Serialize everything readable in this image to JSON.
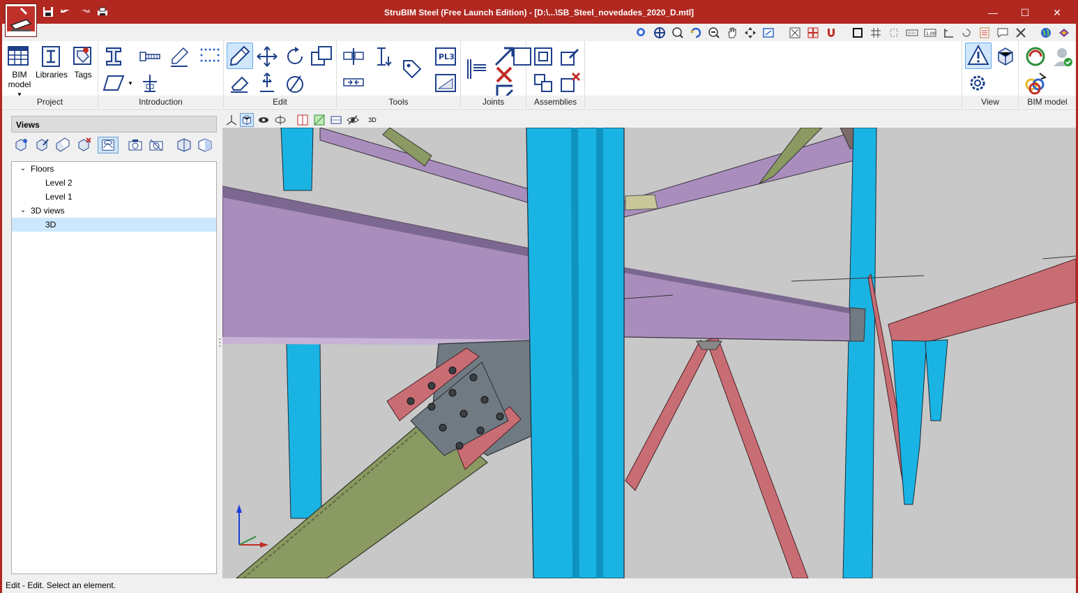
{
  "window": {
    "title": "StruBIM Steel (Free Launch Edition) - [D:\\...\\SB_Steel_novedades_2020_D.mtl]",
    "accent_color": "#b12821"
  },
  "title_controls": {
    "minimize": "—",
    "maximize": "☐",
    "close": "✕"
  },
  "quick_access": [
    "save-icon",
    "undo-icon",
    "redo-icon",
    "print-icon"
  ],
  "ribbon": {
    "project": {
      "label": "Project",
      "bim_model_label": "BIM\nmodel",
      "libraries_label": "Libraries",
      "tags_label": "Tags"
    },
    "introduction": {
      "label": "Introduction"
    },
    "edit": {
      "label": "Edit"
    },
    "tools": {
      "label": "Tools"
    },
    "joints": {
      "label": "Joints"
    },
    "assemblies": {
      "label": "Assemblies"
    },
    "view": {
      "label": "View"
    },
    "bim_model": {
      "label": "BIM model"
    }
  },
  "views_panel": {
    "header": "Views",
    "tree": {
      "floors": "Floors",
      "level2": "Level 2",
      "level1": "Level 1",
      "views3d": "3D views",
      "view3d": "3D"
    }
  },
  "viewport": {
    "toolbar_3d_label": "3D",
    "colors": {
      "column": "#1ab4e4",
      "beam": "#a98ebd",
      "brace": "#c96d74",
      "diagonal_beam": "#8a9a62",
      "plate": "#707a82",
      "background": "#c8c8c8"
    }
  },
  "status": {
    "text": "Edit - Edit. Select an element."
  }
}
